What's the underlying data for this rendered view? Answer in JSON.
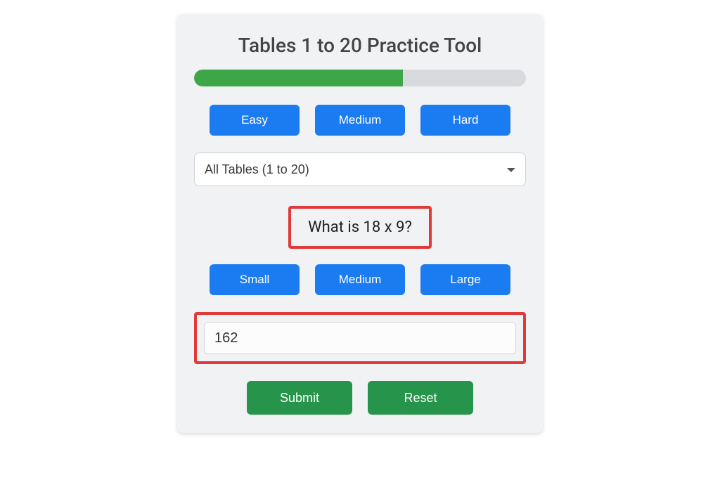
{
  "title": "Tables 1 to 20 Practice Tool",
  "progress_percent": 63,
  "difficulty": {
    "easy": "Easy",
    "medium": "Medium",
    "hard": "Hard"
  },
  "table_select": {
    "selected": "All Tables (1 to 20)"
  },
  "question": "What is 18 x 9?",
  "size": {
    "small": "Small",
    "medium": "Medium",
    "large": "Large"
  },
  "answer_value": "162",
  "actions": {
    "submit": "Submit",
    "reset": "Reset"
  },
  "colors": {
    "blue": "#1b7cf2",
    "green_btn": "#26944b",
    "green_bar": "#3da648",
    "highlight": "#e03a3a",
    "card_bg": "#f1f2f3"
  }
}
